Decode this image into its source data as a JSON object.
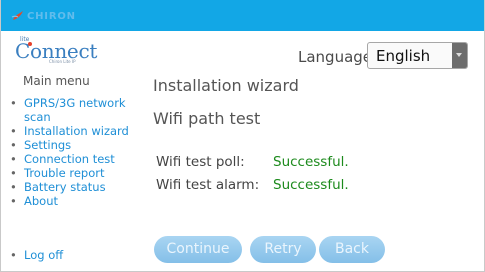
{
  "header": {
    "brand": "CHIRON",
    "brand_color": "#12a7e6"
  },
  "logo": {
    "lite": "lite",
    "main": "Connect",
    "sub": "Chiron Lite IP"
  },
  "language": {
    "label": "Language:",
    "selected": "English"
  },
  "menu": {
    "title": "Main menu",
    "items": [
      "GPRS/3G network scan",
      "Installation wizard",
      "Settings",
      "Connection test",
      "Trouble report",
      "Battery status",
      "About"
    ],
    "logoff": "Log off"
  },
  "main": {
    "title": "Installation wizard",
    "section": "Wifi path test",
    "results": [
      {
        "label": "Wifi test poll:",
        "value": "Successful."
      },
      {
        "label": "Wifi test alarm:",
        "value": "Successful."
      }
    ]
  },
  "buttons": {
    "continue": "Continue",
    "retry": "Retry",
    "back": "Back"
  },
  "colors": {
    "link": "#1f8fd6",
    "success": "#1c8a1c",
    "button": "#a9d5f2"
  }
}
